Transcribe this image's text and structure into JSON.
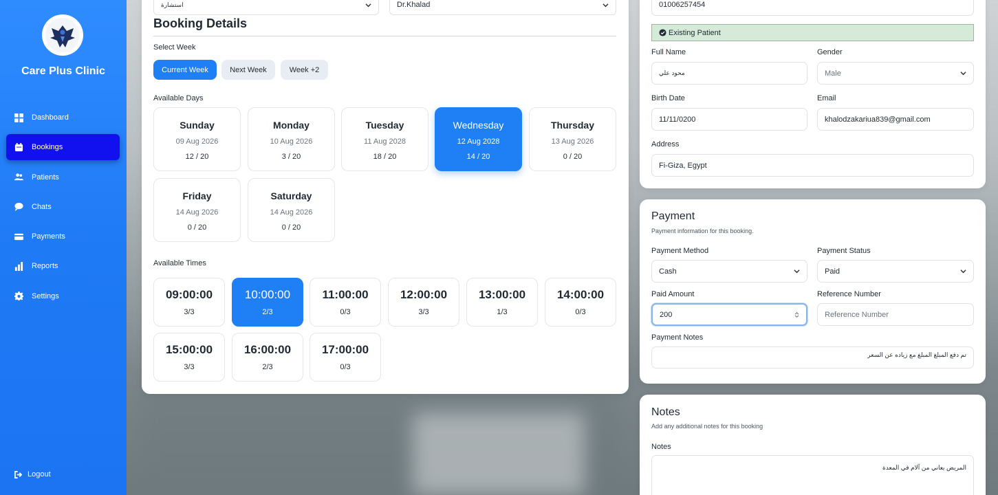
{
  "sidebar": {
    "clinic_name": "Care Plus Clinic",
    "items": [
      {
        "label": "Dashboard",
        "icon": "grid-icon"
      },
      {
        "label": "Bookings",
        "icon": "calendar-icon"
      },
      {
        "label": "Patients",
        "icon": "users-icon"
      },
      {
        "label": "Chats",
        "icon": "chat-icon"
      },
      {
        "label": "Payments",
        "icon": "credit-card-icon"
      },
      {
        "label": "Reports",
        "icon": "bar-chart-icon"
      },
      {
        "label": "Settings",
        "icon": "gear-icon"
      }
    ],
    "active": "Bookings",
    "logout": "Logout"
  },
  "booking": {
    "type_select": "استشارة",
    "doctor_select": "Dr.Khalad",
    "title": "Booking Details",
    "select_week_label": "Select Week",
    "weeks": [
      "Current Week",
      "Next Week",
      "Week +2"
    ],
    "active_week": "Current Week",
    "available_days_label": "Available Days",
    "days": [
      {
        "name": "Sunday",
        "date": "09 Aug 2026",
        "count": "12 / 20"
      },
      {
        "name": "Monday",
        "date": "10 Aug 2026",
        "count": "3 / 20"
      },
      {
        "name": "Tuesday",
        "date": "11 Aug 2028",
        "count": "18 / 20"
      },
      {
        "name": "Wednesday",
        "date": "12 Aug 2028",
        "count": "14 / 20"
      },
      {
        "name": "Thursday",
        "date": "13 Aug 2026",
        "count": "0 / 20"
      },
      {
        "name": "Friday",
        "date": "14 Aug 2026",
        "count": "0 / 20"
      },
      {
        "name": "Saturday",
        "date": "14 Aug 2026",
        "count": "0 / 20"
      }
    ],
    "active_day": "Wednesday",
    "available_times_label": "Available Times",
    "times": [
      {
        "time": "09:00:00",
        "count": "3/3"
      },
      {
        "time": "10:00:00",
        "count": "2/3"
      },
      {
        "time": "11:00:00",
        "count": "0/3"
      },
      {
        "time": "12:00:00",
        "count": "3/3"
      },
      {
        "time": "13:00:00",
        "count": "1/3"
      },
      {
        "time": "14:00:00",
        "count": "0/3"
      },
      {
        "time": "15:00:00",
        "count": "3/3"
      },
      {
        "time": "16:00:00",
        "count": "2/3"
      },
      {
        "time": "17:00:00",
        "count": "0/3"
      }
    ],
    "active_time": "10:00:00"
  },
  "patient": {
    "phone": "01006257454",
    "status_badge": "Existing Patient",
    "full_name_label": "Full Name",
    "full_name": "محود علي",
    "gender_label": "Gender",
    "gender": "Male",
    "birth_date_label": "Birth Date",
    "birth_date": "11/11/0200",
    "email_label": "Email",
    "email": "khalodzakariua839@gmail.com",
    "address_label": "Address",
    "address": "Fi-Giza, Egypt"
  },
  "payment": {
    "title": "Payment",
    "subtitle": "Payment information for this booking.",
    "method_label": "Payment Method",
    "method": "Cash",
    "status_label": "Payment Status",
    "status": "Paid",
    "amount_label": "Paid Amount",
    "amount": "200",
    "reference_label": "Reference Number",
    "reference_placeholder": "Reference Number",
    "notes_label": "Payment Notes",
    "notes": "تم دفع المبلغ المبلغ مع زياده عن السعر"
  },
  "notes": {
    "title": "Notes",
    "subtitle": "Add any additional notes for this booking",
    "label": "Notes",
    "value": "المريض يعاني من آلام في المعدة"
  },
  "colors": {
    "primary": "#1f80f5",
    "sidebar": "#2f8cff",
    "active_nav": "#1111f0",
    "success_bg": "#d6ead9"
  }
}
